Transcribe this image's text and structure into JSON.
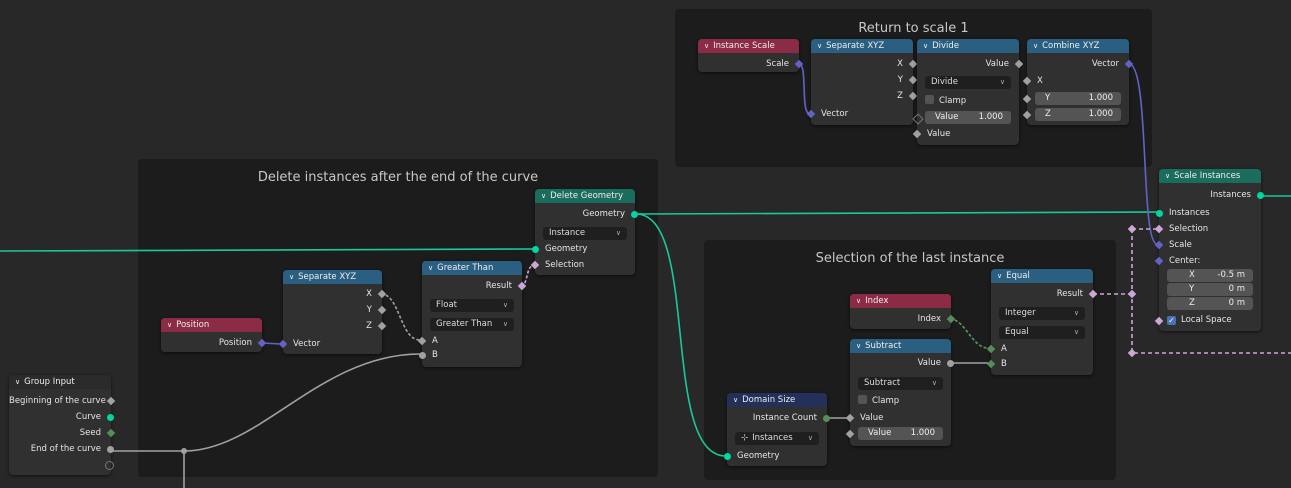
{
  "frames": {
    "return_scale": "Return to scale 1",
    "delete_after": "Delete instances after the end of the curve",
    "selection_last": "Selection of the last instance"
  },
  "nodes": {
    "instance_scale": {
      "title": "Instance Scale",
      "out": "Scale"
    },
    "sep_xyz_top": {
      "title": "Separate XYZ",
      "x": "X",
      "y": "Y",
      "z": "Z",
      "in": "Vector"
    },
    "divide": {
      "title": "Divide",
      "out": "Value",
      "op": "Divide",
      "clamp": "Clamp",
      "field_label": "Value",
      "field_value": "1.000",
      "in": "Value"
    },
    "combine_xyz": {
      "title": "Combine XYZ",
      "out": "Vector",
      "x": "X",
      "y_label": "Y",
      "y_value": "1.000",
      "z_label": "Z",
      "z_value": "1.000"
    },
    "scale_instances": {
      "title": "Scale Instances",
      "out": "Instances",
      "instances": "Instances",
      "selection": "Selection",
      "scale": "Scale",
      "center": "Center:",
      "cx_label": "X",
      "cx_value": "-0.5 m",
      "cy_label": "Y",
      "cy_value": "0 m",
      "cz_label": "Z",
      "cz_value": "0 m",
      "local_space": "Local Space"
    },
    "delete_geometry": {
      "title": "Delete Geometry",
      "out": "Geometry",
      "domain": "Instance",
      "geometry": "Geometry",
      "selection": "Selection"
    },
    "greater_than": {
      "title": "Greater Than",
      "out": "Result",
      "type": "Float",
      "op": "Greater Than",
      "a": "A",
      "b": "B"
    },
    "sep_xyz_mid": {
      "title": "Separate XYZ",
      "x": "X",
      "y": "Y",
      "z": "Z",
      "in": "Vector"
    },
    "position": {
      "title": "Position",
      "out": "Position"
    },
    "group_input": {
      "title": "Group Input",
      "o1": "Beginning of the curve",
      "o2": "Curve",
      "o3": "Seed",
      "o4": "End of the curve"
    },
    "equal": {
      "title": "Equal",
      "out": "Result",
      "type": "Integer",
      "op": "Equal",
      "a": "A",
      "b": "B"
    },
    "index": {
      "title": "Index",
      "out": "Index"
    },
    "subtract": {
      "title": "Subtract",
      "out": "Value",
      "op": "Subtract",
      "clamp": "Clamp",
      "field_label": "Value",
      "field_value": "1.000",
      "in": "Value"
    },
    "domain_size": {
      "title": "Domain Size",
      "out": "Instance Count",
      "domain": "Instances",
      "in": "Geometry"
    }
  },
  "colors": {
    "geometry": "#00d6a3",
    "vector": "#6363c7",
    "float": "#a1a1a1",
    "boolean": "#cca6d6",
    "integer": "#598c5c"
  }
}
